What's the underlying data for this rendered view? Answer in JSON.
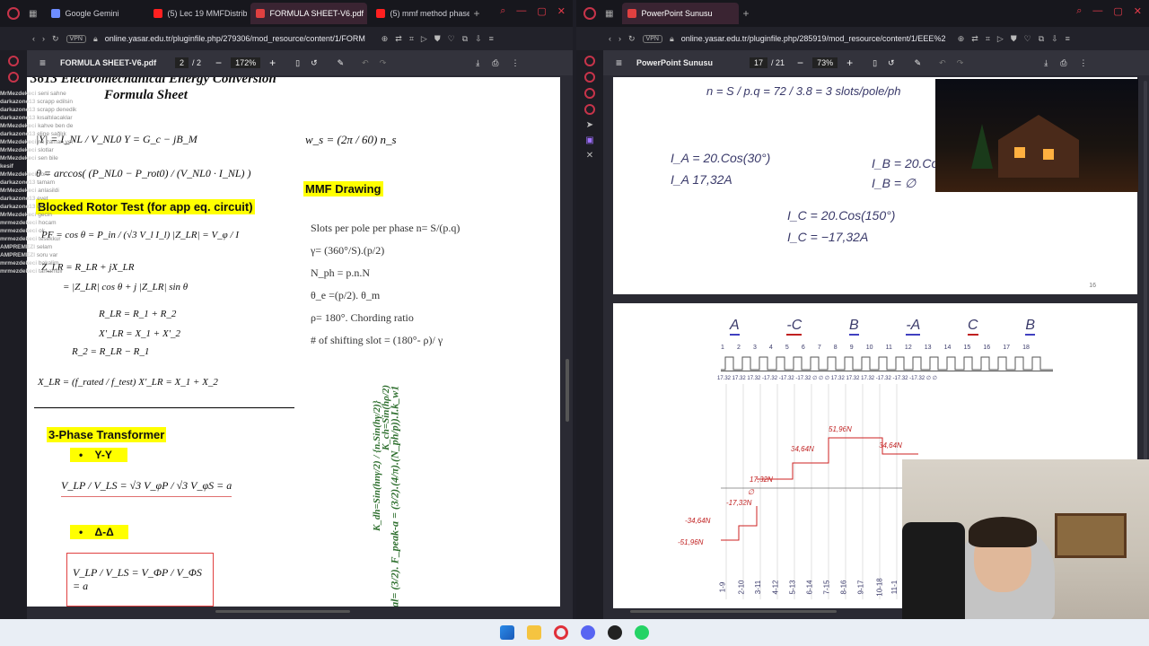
{
  "left_window": {
    "tabs": [
      {
        "label": "Google Gemini",
        "active": false
      },
      {
        "label": "(5) Lec 19 MMFDistrib",
        "active": false
      },
      {
        "label": "FORMULA SHEET-V6.pdf",
        "active": true
      },
      {
        "label": "(5) mmf method phase",
        "active": false
      }
    ],
    "vpn": "VPN",
    "url": "online.yasar.edu.tr/pluginfile.php/279306/mod_resource/content/1/FORM",
    "pdf": {
      "title": "FORMULA SHEET-V6.pdf",
      "page": "2",
      "pages": "/ 2",
      "zoom": "172%"
    },
    "doc": {
      "header1": "3613 Electromechanical Energy Conversion",
      "header2": "Formula Sheet",
      "eq_y": "|Y| = I_NL / V_NL0        Y = G_c − jB_M",
      "eq_theta": "θ = arccos( (P_NL0 − P_rot0) / (V_NL0 · I_NL) )",
      "eq_ws": "w_s = (2π / 60) n_s",
      "blocked_rotor": "Blocked Rotor Test (for app eq. circuit)",
      "eq_pf": "PF = cos θ = P_in / (√3 V_l I_l)      |Z_LR| = V_φ / I",
      "eq_zlr1": "Z_LR = R_LR + jX_LR",
      "eq_zlr2": "= |Z_LR| cos θ + j |Z_LR| sin θ",
      "eq_rlr": "R_LR = R_1 + R_2",
      "eq_xlr": "X'_LR = X_1 + X'_2",
      "eq_r2": "R_2 = R_LR − R_1",
      "eq_xlr2": "X_LR = (f_rated / f_test) X'_LR = X_1 + X_2",
      "mmf_title": "MMF Drawing",
      "mmf_lines": [
        "Slots per pole per phase   n= S/(p.q)",
        "γ= (360°/S).(p/2)",
        "N_ph = p.n.N",
        "θ_e =(p/2). θ_m",
        "ρ= 180°. Chording ratio",
        "# of shifting slot = (180°- ρ)/ γ"
      ],
      "rot1": "F_peak-a = (3/2).(4/π).(N_ph/p)).I.k_w1",
      "rot2": "K_dh=Sin(hnγ/2) / {n.Sin(hγ/2)}",
      "rot3": "K_ch=Sin(hρ/2)",
      "rot0": "-total= (3/2).",
      "transformer_title": "3-Phase Transformer",
      "yy": "Y-Y",
      "eq_yy": "V_LP / V_LS = √3 V_φP / √3 V_φS = a",
      "dd": "Δ-Δ",
      "eq_dd": "V_LP / V_LS = V_ΦP / V_ΦS = a"
    },
    "chat": [
      {
        "name": "MrMezdekeci",
        "msg": "seni sahne"
      },
      {
        "name": "darkazone13",
        "msg": "scrapp edilsin"
      },
      {
        "name": "darkazone13",
        "msg": "scrapp denedik"
      },
      {
        "name": "darkazone13",
        "msg": "kısaltılacaklar"
      },
      {
        "name": "MrMezdekeci",
        "msg": "kahve ben de"
      },
      {
        "name": "darkazone13",
        "msg": "eline sağlık"
      },
      {
        "name": "MrMezdekeci",
        "msg": "ne zaman yer"
      },
      {
        "name": "MrMezdekeci",
        "msg": "slotlar"
      },
      {
        "name": "MrMezdekeci",
        "msg": "sen bile"
      },
      {
        "name": "kesif",
        "msg": ""
      },
      {
        "name": "MrMezdekeci",
        "msg": "soru"
      },
      {
        "name": "darkazone13",
        "msg": "tamam"
      },
      {
        "name": "MrMezdekeci",
        "msg": "anlasildi"
      },
      {
        "name": "darkazone13",
        "msg": "evet"
      },
      {
        "name": "darkazone13",
        "msg": "iyi"
      },
      {
        "name": "MrMezdekeci",
        "msg": "gecin"
      },
      {
        "name": "mrmezdekeci",
        "msg": "hocam"
      },
      {
        "name": "mrmezdekeci",
        "msg": "ok"
      },
      {
        "name": "mrmezdekeci",
        "msg": "tesekkur"
      },
      {
        "name": "AMPREMEZI",
        "msg": "selam"
      },
      {
        "name": "AMPREMEZI",
        "msg": "soru var"
      },
      {
        "name": "mrmezdekeci",
        "msg": "bakalim"
      },
      {
        "name": "mrmezdekeci",
        "msg": "tamamdir"
      }
    ]
  },
  "right_window": {
    "tabs": [
      {
        "label": "PowerPoint Sunusu",
        "active": true
      }
    ],
    "vpn": "VPN",
    "url": "online.yasar.edu.tr/pluginfile.php/285919/mod_resource/content/1/EEE%2",
    "pdf": {
      "title": "PowerPoint Sunusu",
      "page": "17",
      "pages": "/ 21",
      "zoom": "73%"
    },
    "slide1": {
      "eq_n": "n = S / p.q = 72 / 3.8 = 3 slots/pole/ph",
      "ia1": "I_A = 20.Cos(30°)",
      "ia2": "I_A  17,32A",
      "ib1": "I_B = 20.Co",
      "ib2": "I_B = ∅",
      "ic1": "I_C = 20.Cos(150°)",
      "ic2": "I_C = −17,32A",
      "page_num": "16"
    },
    "slide2": {
      "phases": [
        "A",
        "-C",
        "B",
        "-A",
        "C",
        "B"
      ],
      "slots": [
        "1",
        "2",
        "3",
        "4",
        "5",
        "6",
        "7",
        "8",
        "9",
        "10",
        "11",
        "12",
        "13",
        "14",
        "15",
        "16",
        "17",
        "18"
      ],
      "currents": "17.32  17.32  17.32  -17.32  -17.32  -17.32  ∅  ∅  ∅  17.32  17.32  17.32  -17.32  -17.32  -17.32  ∅  ∅",
      "mmf_labels": [
        "51,96N",
        "34,64N",
        "34,64N",
        "17,32N",
        "∅",
        "-17,32N",
        "-34,64N",
        "-51,96N"
      ],
      "x_labels": [
        "1-9",
        "2-10",
        "3-11",
        "4-12",
        "5-13",
        "6-14",
        "7-15",
        "8-16",
        "9-17",
        "10-18",
        "11-1"
      ]
    }
  },
  "taskbar": {
    "icons": [
      "windows-start",
      "file-explorer",
      "opera-browser",
      "discord",
      "chrome",
      "whatsapp"
    ]
  }
}
